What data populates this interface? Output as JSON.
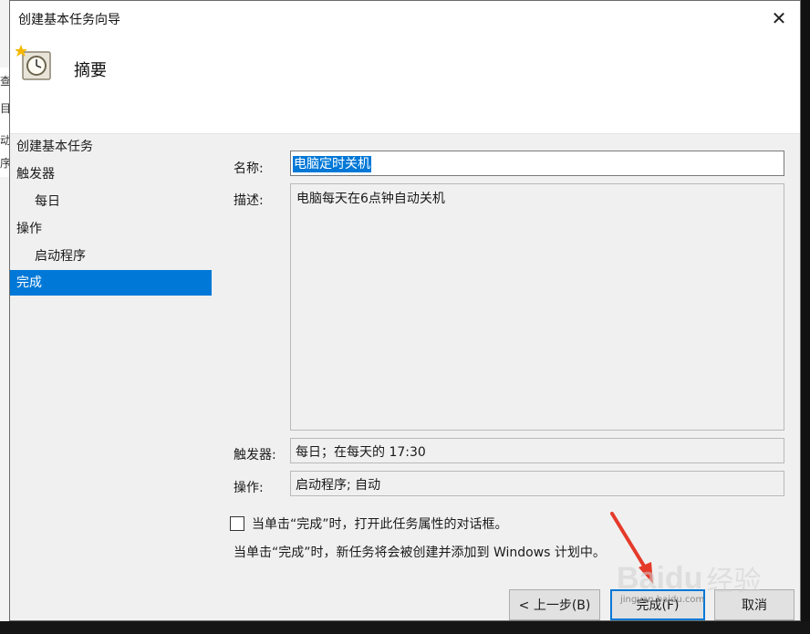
{
  "background": {
    "left_chars": [
      "查",
      "目",
      "动",
      "序"
    ]
  },
  "dialog": {
    "title": "创建基本任务向导",
    "close_glyph": "✕",
    "header_title": "摘要"
  },
  "nav": {
    "items": [
      {
        "label": "创建基本任务"
      },
      {
        "label": "触发器"
      },
      {
        "label": "每日"
      },
      {
        "label": "操作"
      },
      {
        "label": "启动程序"
      },
      {
        "label": "完成"
      }
    ]
  },
  "form": {
    "name_label": "名称:",
    "name_value": "电脑定时关机",
    "desc_label": "描述:",
    "desc_value": "电脑每天在6点钟自动关机",
    "trigger_label": "触发器:",
    "trigger_value": "每日；在每天的 17:30",
    "action_label": "操作:",
    "action_value": "启动程序; 自动",
    "checkbox_label": "当单击“完成”时，打开此任务属性的对话框。",
    "checkbox_checked": false,
    "note": "当单击“完成”时，新任务将会被创建并添加到 Windows 计划中。"
  },
  "buttons": {
    "back": "< 上一步(B)",
    "finish": "完成(F)",
    "cancel": "取消"
  },
  "watermark": {
    "logo": "Baidu",
    "cn": "经验",
    "url": "jingyan.baidu.com"
  },
  "colors": {
    "accent": "#0078d7",
    "arrow": "#e53a2a"
  }
}
